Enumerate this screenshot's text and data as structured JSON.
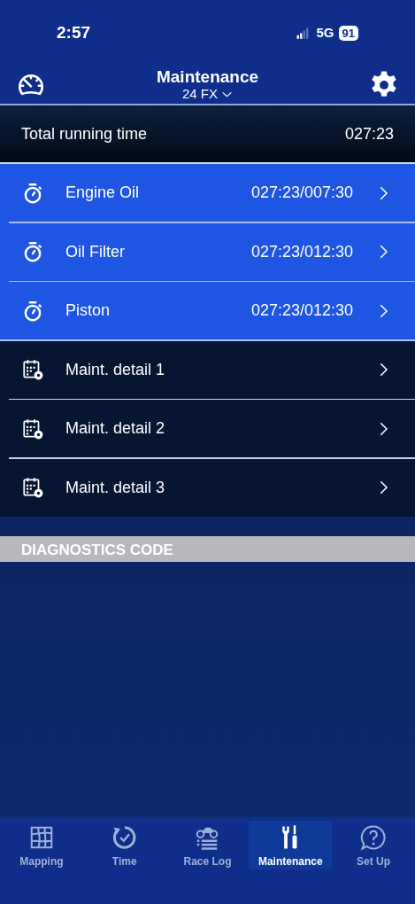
{
  "status_bar": {
    "time": "2:57",
    "network": "5G",
    "battery": "91"
  },
  "header": {
    "title": "Maintenance",
    "subtitle": "24 FX"
  },
  "total": {
    "label": "Total running time",
    "value": "027:23"
  },
  "items": [
    {
      "kind": "timer",
      "label": "Engine Oil",
      "value": "027:23/007:30"
    },
    {
      "kind": "timer",
      "label": "Oil Filter",
      "value": "027:23/012:30"
    },
    {
      "kind": "timer",
      "label": "Piston",
      "value": "027:23/012:30"
    },
    {
      "kind": "schedule",
      "label": "Maint. detail 1"
    },
    {
      "kind": "schedule",
      "label": "Maint. detail 2"
    },
    {
      "kind": "schedule",
      "label": "Maint. detail 3"
    }
  ],
  "section_header": "DIAGNOSTICS CODE",
  "tabs": [
    {
      "kind": "map",
      "label": "Mapping",
      "selected": false
    },
    {
      "kind": "time",
      "label": "Time",
      "selected": false
    },
    {
      "kind": "log",
      "label": "Race Log",
      "selected": false
    },
    {
      "kind": "tools",
      "label": "Maintenance",
      "selected": true
    },
    {
      "kind": "help",
      "label": "Set Up",
      "selected": false
    }
  ]
}
